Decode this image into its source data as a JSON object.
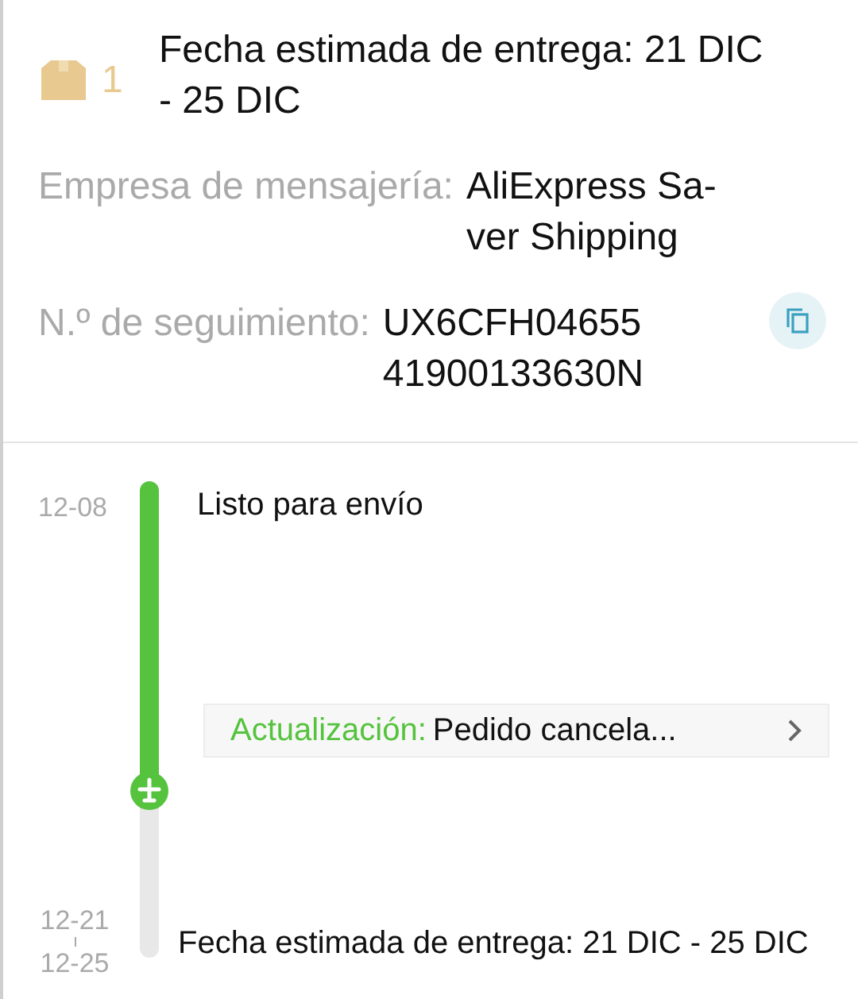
{
  "shipment": {
    "package_count": "1",
    "estimated_delivery": "Fecha estimada de entrega: 21 DIC - 25 DIC",
    "details": [
      {
        "label": "Empresa de mensajería:",
        "value": "AliExpress Sa-\nver Shipping",
        "copyable": false
      },
      {
        "label": "N.º de seguimiento:",
        "value": "UX6CFH04655\n41900133630N",
        "copyable": true
      }
    ]
  },
  "timeline": {
    "level": 0.65,
    "events": [
      {
        "kind": "event",
        "date": "12-08",
        "text": "Listo para envío"
      },
      {
        "kind": "update",
        "label": "Actualización:",
        "text": "Pedido cancela..."
      },
      {
        "kind": "estimate",
        "date_from": "12-21",
        "date_to": "12-25",
        "text": "Fecha estimada de entrega: 21 DIC - 25 DIC"
      }
    ]
  }
}
